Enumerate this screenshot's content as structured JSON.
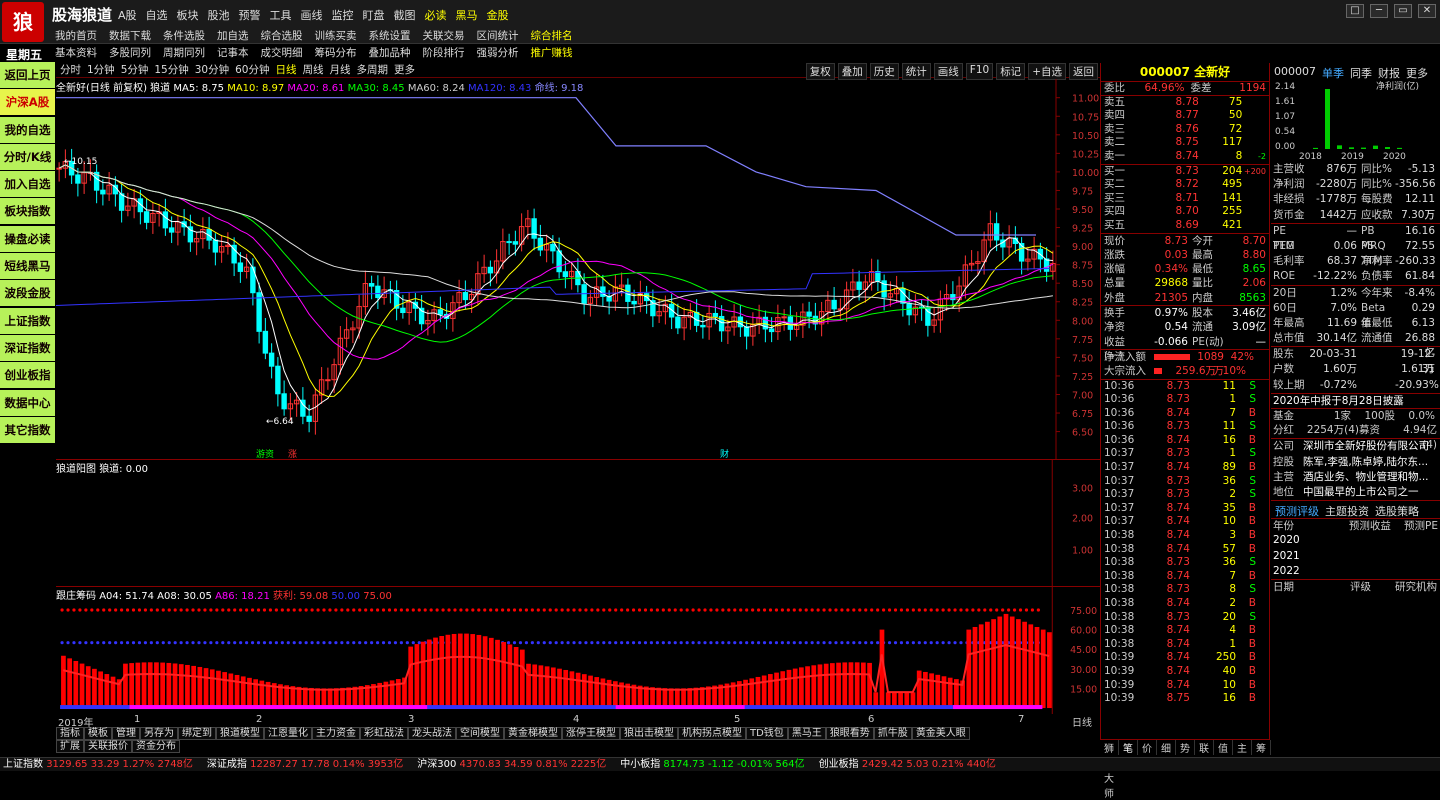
{
  "brand": "股海狼道",
  "logo_char": "狼",
  "menu1": [
    "A股",
    "自选",
    "板块",
    "股池",
    "预警",
    "工具",
    "画线",
    "监控",
    "盯盘",
    "截图",
    "必读",
    "黑马",
    "金股"
  ],
  "menu1_highlight": [
    "必读",
    "黑马",
    "金股"
  ],
  "menu2": [
    "我的首页",
    "数据下载",
    "条件选股",
    "加自选",
    "综合选股",
    "训练买卖",
    "系统设置",
    "关联交易",
    "区间统计",
    "综合排名"
  ],
  "menu3": [
    "基本资料",
    "多股同列",
    "周期同列",
    "记事本",
    "成交明细",
    "筹码分布",
    "叠加品种",
    "阶段排行",
    "强弱分析",
    "推广赚钱"
  ],
  "weekday": "星期五",
  "win_buttons": [
    "□",
    "─",
    "▭",
    "✕"
  ],
  "sidebar": [
    "返回上页",
    "沪深A股",
    "我的自选",
    "分时/K线",
    "加入自选",
    "板块指数",
    "操盘必读",
    "短线黑马",
    "波段金股",
    "上证指数",
    "深证指数",
    "创业板指",
    "数据中心",
    "其它指数"
  ],
  "sidebar_active": "沪深A股",
  "periods": [
    "分时",
    "1分钟",
    "5分钟",
    "15分钟",
    "30分钟",
    "60分钟",
    "日线",
    "周线",
    "月线",
    "多周期",
    "更多"
  ],
  "period_active": "日线",
  "chart_buttons": [
    "复权",
    "叠加",
    "历史",
    "统计",
    "画线",
    "F10",
    "标记",
    "+自选",
    "返回"
  ],
  "legend_main": {
    "name": "全新好(日线 前复权)",
    "ind": "狼道",
    "ma5": "MA5: 8.75",
    "ma10": "MA10: 8.97",
    "ma20": "MA20: 8.61",
    "ma30": "MA30: 8.45",
    "ma60": "MA60: 8.24",
    "ma120": "MA120: 8.43",
    "cmd": "命线: 9.18"
  },
  "legend_sub1": {
    "name": "狼道阳图",
    "val": "狼道: 0.00"
  },
  "legend_sub2": {
    "name": "跟庄筹码",
    "a04": "A04: 51.74",
    "a08": "A08: 30.05",
    "a86": "A86: 18.21",
    "x1": "获利: 59.08",
    "x2": "50.00",
    "x3": "75.00"
  },
  "main_yaxis": [
    "11.00",
    "10.75",
    "10.50",
    "10.25",
    "10.00",
    "9.75",
    "9.50",
    "9.25",
    "9.00",
    "8.75",
    "8.50",
    "8.25",
    "8.00",
    "7.75",
    "7.50",
    "7.25",
    "7.00",
    "6.75",
    "6.50"
  ],
  "sub1_yaxis": [
    "3.00",
    "2.00",
    "1.00"
  ],
  "sub2_yaxis": [
    "75.00",
    "60.00",
    "45.00",
    "30.00",
    "15.00"
  ],
  "annot_high": "10.15",
  "annot_low": "6.64",
  "markers": [
    "游资",
    "涨",
    "财"
  ],
  "date_labels": [
    "2019年",
    "1",
    "2",
    "3",
    "4",
    "5",
    "6",
    "7"
  ],
  "date_period": "日线",
  "bottom_tabs": [
    "指标",
    "模板",
    "管理",
    "另存为",
    "绑定到",
    "狼道模型",
    "江恩量化",
    "主力资金",
    "彩虹战法",
    "龙头战法",
    "空间模型",
    "黄金梯模型",
    "涨停王模型",
    "狼出击模型",
    "机构拐点模型",
    "TD钱包",
    "黑马王",
    "狼眼看势",
    "抓牛股",
    "黄金美人眼"
  ],
  "bottom_tabs2": [
    "扩展",
    "关联报价",
    "资金分布"
  ],
  "stock": {
    "code": "000007",
    "name": "全新好"
  },
  "wb": {
    "label": "委比",
    "pct": "64.96%",
    "label2": "委差",
    "val": "1194"
  },
  "asks": [
    [
      "卖五",
      "8.78",
      "75",
      ""
    ],
    [
      "卖四",
      "8.77",
      "50",
      ""
    ],
    [
      "卖三",
      "8.76",
      "72",
      ""
    ],
    [
      "卖二",
      "8.75",
      "117",
      ""
    ],
    [
      "卖一",
      "8.74",
      "8",
      "-2"
    ]
  ],
  "bids": [
    [
      "买一",
      "8.73",
      "204",
      "+200"
    ],
    [
      "买二",
      "8.72",
      "495",
      ""
    ],
    [
      "买三",
      "8.71",
      "141",
      ""
    ],
    [
      "买四",
      "8.70",
      "255",
      ""
    ],
    [
      "买五",
      "8.69",
      "421",
      ""
    ]
  ],
  "stats": [
    [
      "现价",
      "8.73",
      "今开",
      "8.70"
    ],
    [
      "涨跌",
      "0.03",
      "最高",
      "8.80"
    ],
    [
      "涨幅",
      "0.34%",
      "最低",
      "8.65"
    ],
    [
      "总量",
      "29868",
      "量比",
      "2.06"
    ],
    [
      "外盘",
      "21305",
      "内盘",
      "8563"
    ]
  ],
  "stats2": [
    [
      "换手",
      "0.97%",
      "股本",
      "3.46亿"
    ],
    [
      "净资",
      "0.54",
      "流通",
      "3.09亿"
    ],
    [
      "收益(一)",
      "-0.066",
      "PE(动)",
      "—"
    ]
  ],
  "flow": [
    [
      "净流入额",
      "1089万",
      "42%"
    ],
    [
      "大宗流入",
      "259.6万",
      "10%"
    ]
  ],
  "ticks": [
    [
      "10:36",
      "8.73",
      "11",
      "S"
    ],
    [
      "10:36",
      "8.73",
      "1",
      "S"
    ],
    [
      "10:36",
      "8.74",
      "7",
      "B"
    ],
    [
      "10:36",
      "8.73",
      "11",
      "S"
    ],
    [
      "10:36",
      "8.74",
      "16",
      "B"
    ],
    [
      "10:37",
      "8.73",
      "1",
      "S"
    ],
    [
      "10:37",
      "8.74",
      "89",
      "B"
    ],
    [
      "10:37",
      "8.73",
      "36",
      "S"
    ],
    [
      "10:37",
      "8.73",
      "2",
      "S"
    ],
    [
      "10:37",
      "8.74",
      "35",
      "B"
    ],
    [
      "10:37",
      "8.74",
      "10",
      "B"
    ],
    [
      "10:38",
      "8.74",
      "3",
      "B"
    ],
    [
      "10:38",
      "8.74",
      "57",
      "B"
    ],
    [
      "10:38",
      "8.73",
      "36",
      "S"
    ],
    [
      "10:38",
      "8.74",
      "7",
      "B"
    ],
    [
      "10:38",
      "8.73",
      "8",
      "S"
    ],
    [
      "10:38",
      "8.74",
      "2",
      "B"
    ],
    [
      "10:38",
      "8.73",
      "20",
      "S"
    ],
    [
      "10:38",
      "8.74",
      "4",
      "B"
    ],
    [
      "10:38",
      "8.74",
      "1",
      "B"
    ],
    [
      "10:39",
      "8.74",
      "250",
      "B"
    ],
    [
      "10:39",
      "8.74",
      "40",
      "B"
    ],
    [
      "10:39",
      "8.74",
      "10",
      "B"
    ],
    [
      "10:39",
      "8.75",
      "16",
      "B"
    ]
  ],
  "quote_bottom_tabs": [
    "狮动大师",
    "笔",
    "价",
    "细",
    "势",
    "联",
    "值",
    "主",
    "筹"
  ],
  "f10_tabs": [
    "000007",
    "单季",
    "同季",
    "财报",
    "更多"
  ],
  "f10_tab_active": "单季",
  "f10_chart": {
    "ylabels": [
      "2.14",
      "1.61",
      "1.07",
      "0.54",
      "0.00"
    ],
    "years": [
      "2018",
      "2019",
      "2020"
    ],
    "title": "净利润(亿)",
    "values": [
      0.04,
      2.14,
      0.13,
      0.06,
      0.05,
      0.12,
      0.07,
      0.04
    ]
  },
  "f10_rows": [
    [
      "主营收",
      "876万",
      "同比%",
      "-5.13"
    ],
    [
      "净利润",
      "-2280万",
      "同比%",
      "-356.56"
    ],
    [
      "非经损",
      "-1778万",
      "每股费",
      "12.11万"
    ],
    [
      "货币金",
      "1442万",
      "应收款",
      "7.30万"
    ]
  ],
  "f10_rows2": [
    [
      "PE TTM",
      "—",
      "PB MRQ",
      "16.16"
    ],
    [
      "PEG",
      "0.06",
      "PS TTM",
      "72.55"
    ],
    [
      "毛利率",
      "68.37",
      "净利率",
      "-260.33"
    ],
    [
      "ROE",
      "-12.22%",
      "负债率",
      "61.84"
    ]
  ],
  "f10_rows3": [
    [
      "20日",
      "1.2%",
      "今年来",
      "-8.4%"
    ],
    [
      "60日",
      "7.0%",
      "Beta值",
      "0.29"
    ],
    [
      "年最高",
      "11.69",
      "年最低",
      "6.13"
    ],
    [
      "总市值",
      "30.14亿",
      "流通值",
      "26.88亿"
    ]
  ],
  "f10_rows4": [
    [
      "股东",
      "20-03-31",
      "",
      "19-12-31"
    ],
    [
      "户数",
      "1.60万",
      "",
      "1.61万"
    ],
    [
      "较上期",
      "-0.72%",
      "",
      "-20.93%"
    ]
  ],
  "notice": "2020年中报于8月28日披露",
  "fund": [
    "基金",
    "1家",
    "100股",
    "0.0%"
  ],
  "bonus": [
    "分红",
    "2254万(4)",
    "募资",
    "4.94亿(4)"
  ],
  "company": [
    [
      "公司",
      "深圳市全新好股份有限公司"
    ],
    [
      "控股",
      "陈军,李强,陈卓婷,陆尔东..."
    ],
    [
      "主营",
      "酒店业务、物业管理和物..."
    ],
    [
      "地位",
      "中国最早的上市公司之一"
    ]
  ],
  "eval_tabs": [
    "预测评级",
    "主题投资",
    "选股策略"
  ],
  "eval_head": [
    "年份",
    "预测收益",
    "预测PE"
  ],
  "eval_years": [
    "2020",
    "2021",
    "2022"
  ],
  "rating_head": [
    "日期",
    "评级",
    "研究机构"
  ],
  "status": [
    {
      "name": "上证指数",
      "val": "3129.65 33.29 1.27% 2748亿"
    },
    {
      "name": "深证成指",
      "val": "12287.27 17.78 0.14% 3953亿"
    },
    {
      "name": "沪深300",
      "val": "4370.83 34.59 0.81% 2225亿"
    },
    {
      "name": "中小板指",
      "val": "8174.73 -1.12 -0.01% 564亿"
    },
    {
      "name": "创业板指",
      "val": "2429.42 5.03 0.21% 440亿"
    }
  ],
  "colors": {
    "up": "#ff3333",
    "down": "#00ffff",
    "ma5": "#ffffff",
    "ma10": "#ffff00",
    "ma20": "#ff00ff",
    "ma30": "#00ff00",
    "ma60": "#3333ff",
    "cmd": "#8080ff"
  }
}
